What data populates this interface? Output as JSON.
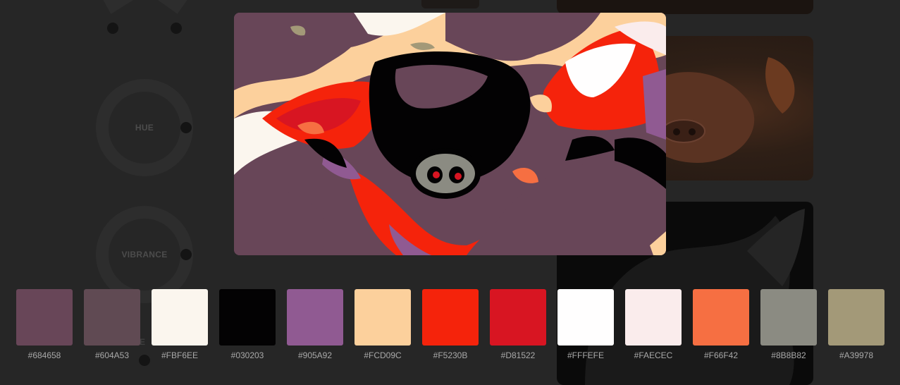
{
  "background_app": {
    "dials": [
      {
        "label": "HUE"
      },
      {
        "label": "VIBRANCE"
      }
    ],
    "partial_label": "VE"
  },
  "palette": [
    {
      "hex": "#684658",
      "color": "#684658"
    },
    {
      "hex": "#604A53",
      "color": "#604A53"
    },
    {
      "hex": "#FBF6EE",
      "color": "#FBF6EE"
    },
    {
      "hex": "#030203",
      "color": "#030203"
    },
    {
      "hex": "#905A92",
      "color": "#905A92"
    },
    {
      "hex": "#FCD09C",
      "color": "#FCD09C"
    },
    {
      "hex": "#F5230B",
      "color": "#F5230B"
    },
    {
      "hex": "#D81522",
      "color": "#D81522"
    },
    {
      "hex": "#FFFEFE",
      "color": "#FFFEFE"
    },
    {
      "hex": "#FAECEC",
      "color": "#FAECEC"
    },
    {
      "hex": "#F66F42",
      "color": "#F66F42"
    },
    {
      "hex": "#8B8B82",
      "color": "#8B8B82"
    },
    {
      "hex": "#A39978",
      "color": "#A39978"
    }
  ]
}
